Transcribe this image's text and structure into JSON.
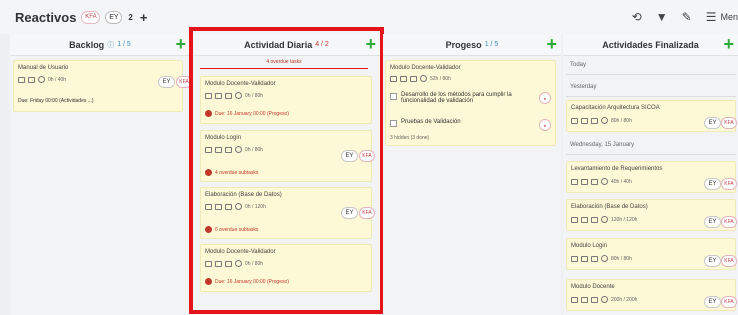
{
  "topbar": {
    "title": "Reactivos",
    "kfa_chip": "KFA",
    "ey_chip": "EY",
    "count": "2",
    "add": "+",
    "history_icon": "history-icon",
    "filter_icon": "filter-icon",
    "edit_icon": "pencil-icon",
    "menu_icon": "hamburger-icon",
    "menu_label": "Men"
  },
  "columns": [
    {
      "title": "Backlog",
      "sub": "1 / 5",
      "add": "+"
    },
    {
      "title": "Actividad Diaria",
      "sub": "4 / 2",
      "add": "+",
      "overdue": "4 overdue tasks"
    },
    {
      "title": "Progeso",
      "sub": "1 / 5",
      "add": "+"
    },
    {
      "title": "Actividades Finalizada",
      "sub": "",
      "add": "+"
    }
  ],
  "backlog": {
    "card": {
      "title": "Manual de Usuario",
      "hours": "0h / 40h",
      "due": "Due: Friday 00:00 (Actividades ...)",
      "ey": "EY",
      "kfa": "KFA"
    }
  },
  "daily": {
    "cards": [
      {
        "title": "Modulo Docente-Validador",
        "hours": "0h / 80h",
        "due": "Due: 16 January 00:00 (Progeso)"
      },
      {
        "title": "Modulo Login",
        "hours": "0h / 80h",
        "warn": "4 overdue subtasks",
        "ey": "EY",
        "kfa": "KFA"
      },
      {
        "title": "Elaboración (Base de Datos)",
        "hours": "0h / 120h",
        "warn": "6 overdue subtasks",
        "ey": "EY",
        "kfa": "KFA"
      },
      {
        "title": "Modulo Docente-Validador",
        "hours": "0h / 80h",
        "due": "Due: 16 January 00:00 (Progeso)"
      }
    ]
  },
  "progress": {
    "card": {
      "title": "Modulo Docente-Validador",
      "hours": "52h / 80h"
    },
    "items": [
      "Desarrollo de los métodos para cumplir la funcionalidad de validación",
      "Pruebas de Validación"
    ],
    "hidden": "3 hidden (3 done)"
  },
  "finished": {
    "today": "Today",
    "yesterday": "Yesterday",
    "wednesday": "Wednesday, 15 January",
    "cards": [
      {
        "title": "Capacitación Arquitectura SICOA",
        "hours": "80h / 80h"
      },
      {
        "title": "Levantamiento de Requerimientos",
        "hours": "40h / 40h"
      },
      {
        "title": "Elaboración (Base de Datos)",
        "hours": "120h / 120h"
      },
      {
        "title": "Modulo Login",
        "hours": "80h / 80h"
      },
      {
        "title": "Modulo Docente",
        "hours": "200h / 200h"
      }
    ],
    "ey": "EY",
    "kfa": "KFA"
  }
}
